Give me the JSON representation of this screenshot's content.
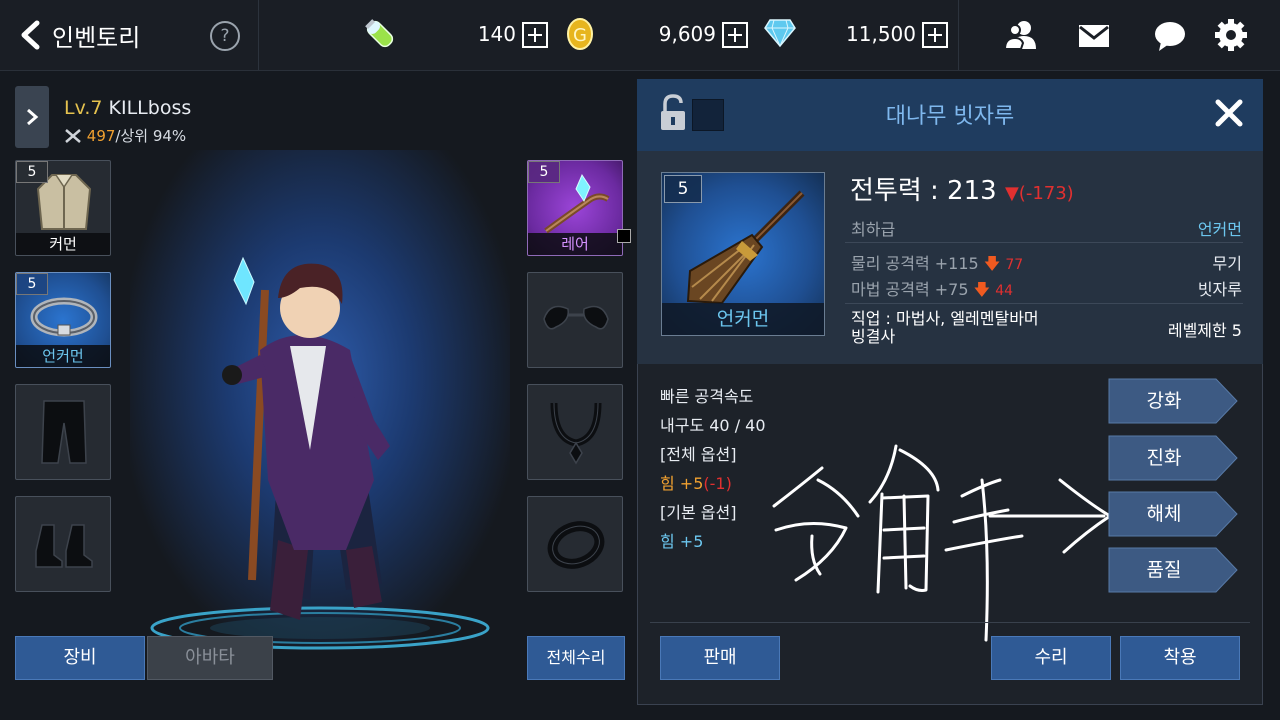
{
  "header": {
    "title": "인벤토리",
    "help": "?",
    "stamina": "140",
    "gold": "9,609",
    "gems": "11,500"
  },
  "character": {
    "level": "Lv.7",
    "name": "KILLboss",
    "power": "497",
    "rank": "/상위 94%"
  },
  "left_slots": [
    {
      "level": "5",
      "label": "커먼"
    },
    {
      "level": "5",
      "label": "언커먼"
    }
  ],
  "right_slots": [
    {
      "level": "5",
      "label": "레어"
    }
  ],
  "left_buttons": {
    "equip": "장비",
    "avatar": "아바타",
    "repair_all": "전체수리"
  },
  "item": {
    "title": "대나무 빗자루",
    "level": "5",
    "rarity_label": "언커먼",
    "combat_power_label": "전투력 : 213",
    "combat_power_diff": "(-173)",
    "grade": "최하급",
    "rarity": "언커먼",
    "phys_attack": "물리 공격력 +115",
    "phys_attack_diff": "77",
    "magic_attack": "마법 공격력 +75",
    "magic_attack_diff": "44",
    "type": "무기",
    "subtype": "빗자루",
    "class_line1": "직업 : 마법사, 엘레멘탈바머",
    "class_line2": "빙결사",
    "level_req": "레벨제한 5",
    "props": [
      "빠른 공격속도",
      "내구도 40 / 40",
      "[전체 옵션]",
      "힘 +5",
      "(-1)",
      "[기본 옵션]",
      "힘 +5"
    ],
    "actions": [
      "강화",
      "진화",
      "해체",
      "품질"
    ],
    "bottom_buttons": {
      "sell": "판매",
      "repair": "수리",
      "equip": "착용"
    }
  },
  "colors": {
    "accent_blue": "#2f5a95",
    "title_blue": "#7fb8ee",
    "gold_text": "#e5c24f",
    "orange_text": "#f0a030",
    "red_text": "#e03030",
    "cyan_text": "#6cc6ee"
  }
}
